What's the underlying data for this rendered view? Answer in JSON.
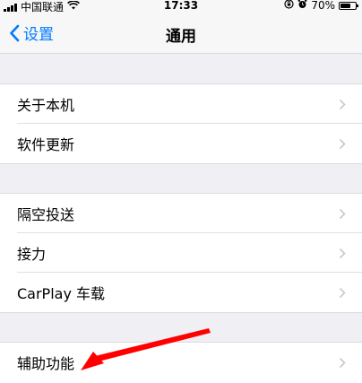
{
  "status_bar": {
    "carrier": "中国联通",
    "time": "17:33",
    "battery": "70%",
    "battery_level": 0.7,
    "wifi_icon": "wifi-icon",
    "lock_icon": "orientation-lock-icon",
    "alarm_icon": "alarm-icon"
  },
  "nav": {
    "back_label": "设置",
    "title": "通用"
  },
  "groups": [
    {
      "items": [
        {
          "label": "关于本机"
        },
        {
          "label": "软件更新"
        }
      ]
    },
    {
      "items": [
        {
          "label": "隔空投送"
        },
        {
          "label": "接力"
        },
        {
          "label": "CarPlay 车载"
        }
      ]
    },
    {
      "items": [
        {
          "label": "辅助功能"
        }
      ]
    }
  ],
  "colors": {
    "accent": "#007aff",
    "background": "#efeff4",
    "annotation_arrow": "#ff0000"
  }
}
